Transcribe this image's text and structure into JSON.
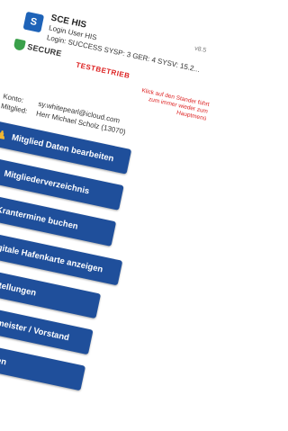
{
  "header": {
    "app_icon_text": "S",
    "app_title": "SCE HIS",
    "login_user": "Login User HIS",
    "login_status": "Login: SUCCESS SYSP: 3 GER: 4 SYSV: 15.2...",
    "version": "v8.5",
    "secure_text": "SECURE",
    "testbetrieb": "TESTBETRIEB",
    "hint": "Klick auf den Stander führt zum immer wieder zum Hauptmenü"
  },
  "account": {
    "konto_label": "Konto:",
    "konto_value": "sy.whitepearl@icloud.com",
    "mitglied_label": "Mitglied:",
    "mitglied_value": "Herr Michael Scholz (13070)"
  },
  "menu": {
    "items": [
      {
        "label": "Mitglied Daten bearbeiten",
        "icon": "person-key-icon"
      },
      {
        "label": "Mitgliederverzeichnis",
        "icon": "globe-icon"
      },
      {
        "label": "Krantermine buchen",
        "icon": "calendar-icon"
      },
      {
        "label": "Digitale Hafenkarte anzeigen",
        "icon": "card-grid-icon"
      },
      {
        "label": "Einstellungen",
        "icon": "person-settings-icon"
      },
      {
        "label": "Hafenmeister / Vorstand",
        "icon": "person-settings-icon"
      },
      {
        "label": "Abmelden",
        "icon": "close-circle-icon"
      }
    ]
  },
  "colors": {
    "button_bg": "#1f4f9b",
    "icon_accent": "#f2b632",
    "warning_red": "#dd2222",
    "secure_green": "#3aa04a"
  }
}
